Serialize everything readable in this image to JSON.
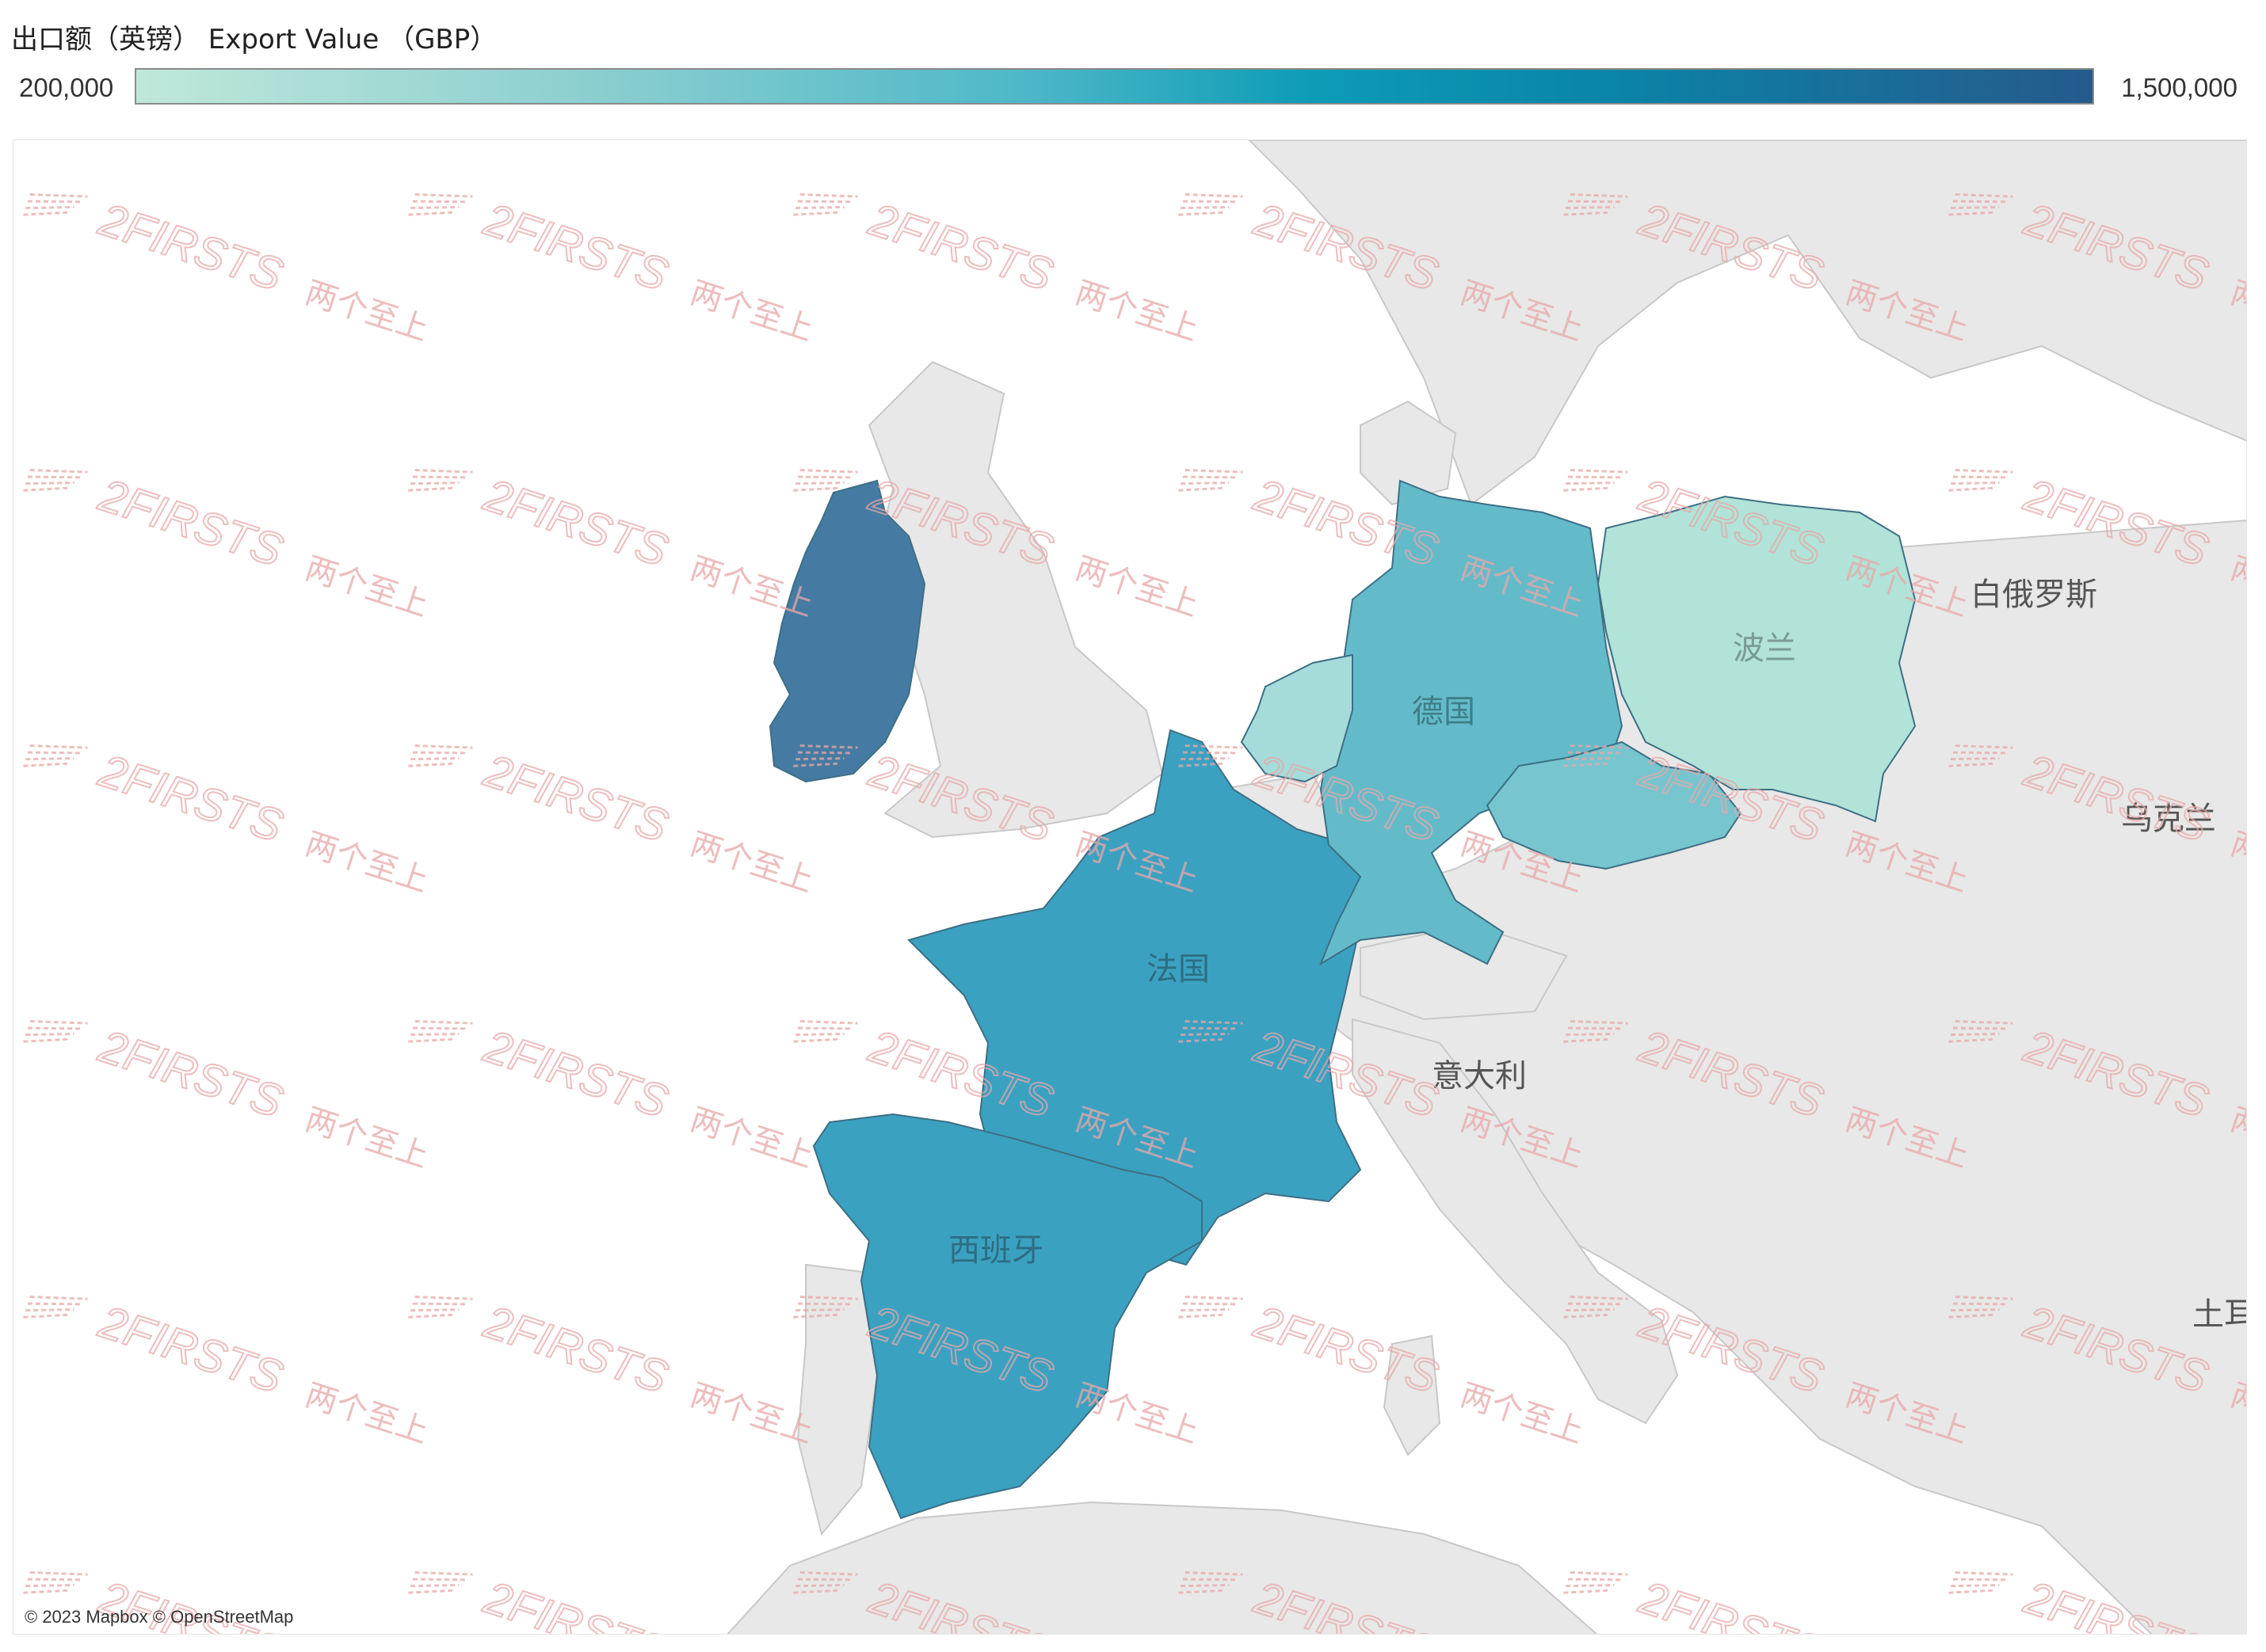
{
  "legend": {
    "title": "出口额（英镑） Export Value （GBP）",
    "min_label": "200,000",
    "max_label": "1,500,000",
    "color_low": "#bfe8da",
    "color_high": "#245a8c"
  },
  "map": {
    "attribution": "© 2023 Mapbox © OpenStreetMap",
    "labels": {
      "belarus": "白俄罗斯",
      "poland": "波兰",
      "germany": "德国",
      "france": "法国",
      "ukraine": "乌克兰",
      "italy": "意大利",
      "spain": "西班牙",
      "turkey": "土耳"
    },
    "countries": [
      {
        "name": "Ireland",
        "fill": "#457ba3"
      },
      {
        "name": "France",
        "fill": "#3ba1c1"
      },
      {
        "name": "Spain",
        "fill": "#3ba1c1"
      },
      {
        "name": "Germany",
        "fill": "#63bbca"
      },
      {
        "name": "Czechia",
        "fill": "#77c5cf"
      },
      {
        "name": "Netherlands",
        "fill": "#a5dcd9"
      },
      {
        "name": "Poland",
        "fill": "#b1e3d8"
      }
    ],
    "watermark": {
      "brand": "2FIRSTS",
      "cn": "两个至上",
      "color": "#e8a8a8"
    }
  }
}
